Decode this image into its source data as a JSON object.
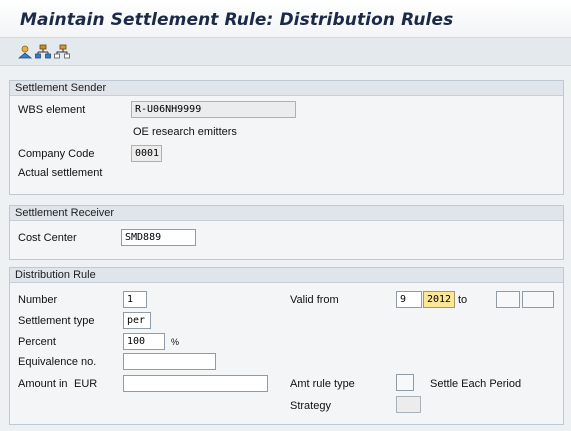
{
  "title": "Maintain Settlement Rule: Distribution Rules",
  "toolbar": {
    "icons": [
      "person-icon",
      "hierarchy-icon",
      "network-icon"
    ]
  },
  "sender": {
    "header": "Settlement Sender",
    "wbs_label": "WBS element",
    "wbs_value": "R-U06NH9999",
    "wbs_desc": "OE research emitters",
    "company_code_label": "Company Code",
    "company_code_value": "0001",
    "actual_settlement": "Actual settlement"
  },
  "receiver": {
    "header": "Settlement Receiver",
    "cost_center_label": "Cost Center",
    "cost_center_value": "SMD889"
  },
  "rule": {
    "header": "Distribution Rule",
    "number_label": "Number",
    "number_value": "1",
    "settlement_type_label": "Settlement type",
    "settlement_type_value": "per",
    "percent_label": "Percent",
    "percent_value": "100",
    "percent_unit": "%",
    "equivalence_label": "Equivalence no.",
    "equivalence_value": "",
    "amount_label": "Amount in",
    "amount_currency": "EUR",
    "amount_value": "",
    "valid_from_label": "Valid from",
    "valid_from_period": "9",
    "valid_from_year": "2012",
    "to_label": "to",
    "valid_to_period": "",
    "valid_to_year": "",
    "amt_rule_type_label": "Amt rule type",
    "amt_rule_type_value": "",
    "settle_each_period": "Settle Each Period",
    "strategy_label": "Strategy",
    "strategy_value": ""
  }
}
